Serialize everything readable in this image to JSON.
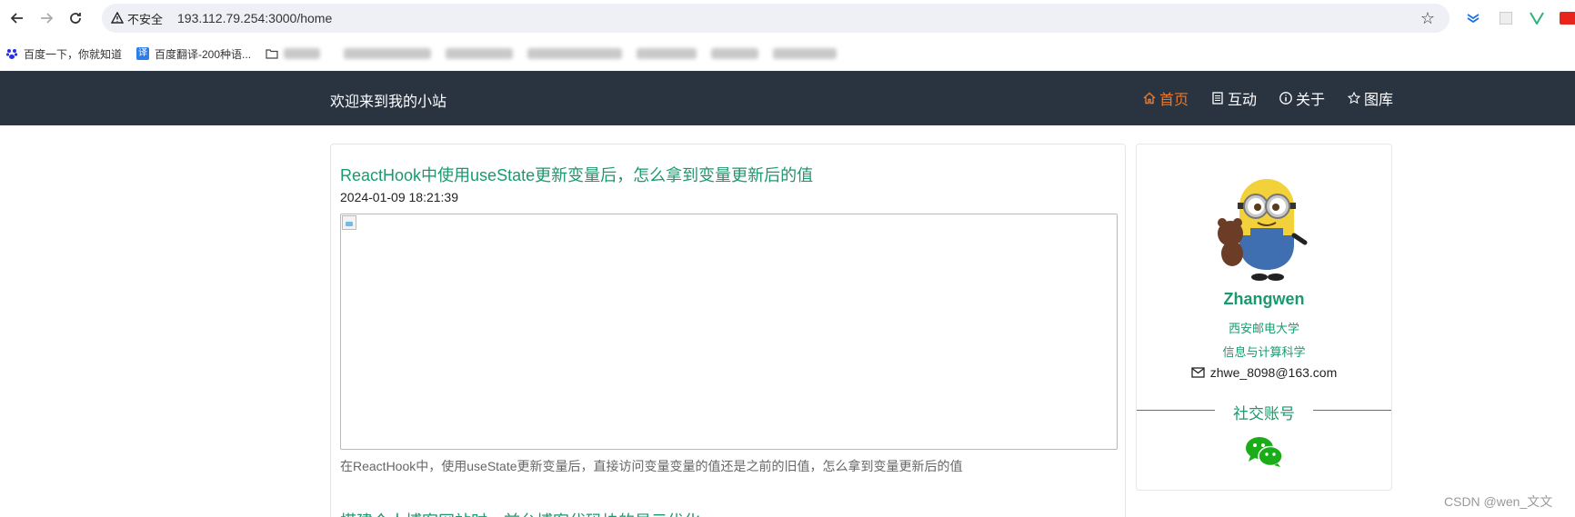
{
  "browser": {
    "security_label": "不安全",
    "url": "193.112.79.254:3000/home",
    "bookmarks": [
      {
        "label": "百度一下，你就知道"
      },
      {
        "label": "百度翻译-200种语..."
      }
    ]
  },
  "site": {
    "brand": "欢迎来到我的小站",
    "nav": [
      {
        "label": "首页",
        "icon": "home-icon",
        "active": true
      },
      {
        "label": "互动",
        "icon": "document-icon",
        "active": false
      },
      {
        "label": "关于",
        "icon": "info-icon",
        "active": false
      },
      {
        "label": "图库",
        "icon": "star-icon",
        "active": false
      }
    ]
  },
  "posts": [
    {
      "title": "ReactHook中使用useState更新变量后，怎么拿到变量更新后的值",
      "date": "2024-01-09 18:21:39",
      "summary": "在ReactHook中，使用useState更新变量后，直接访问变量变量的值还是之前的旧值，怎么拿到变量更新后的值"
    },
    {
      "title": "搭建个人博客网站时，前台博客代码块的显示优化"
    }
  ],
  "profile": {
    "name": "Zhangwen",
    "school": "西安邮电大学",
    "major": "信息与计算科学",
    "email": "zhwe_8098@163.com",
    "social_heading": "社交账号"
  },
  "watermark": "CSDN @wen_文文",
  "colors": {
    "accent_green": "#1a9a6c",
    "nav_bg": "#2a3441",
    "nav_active": "#e6792d"
  }
}
